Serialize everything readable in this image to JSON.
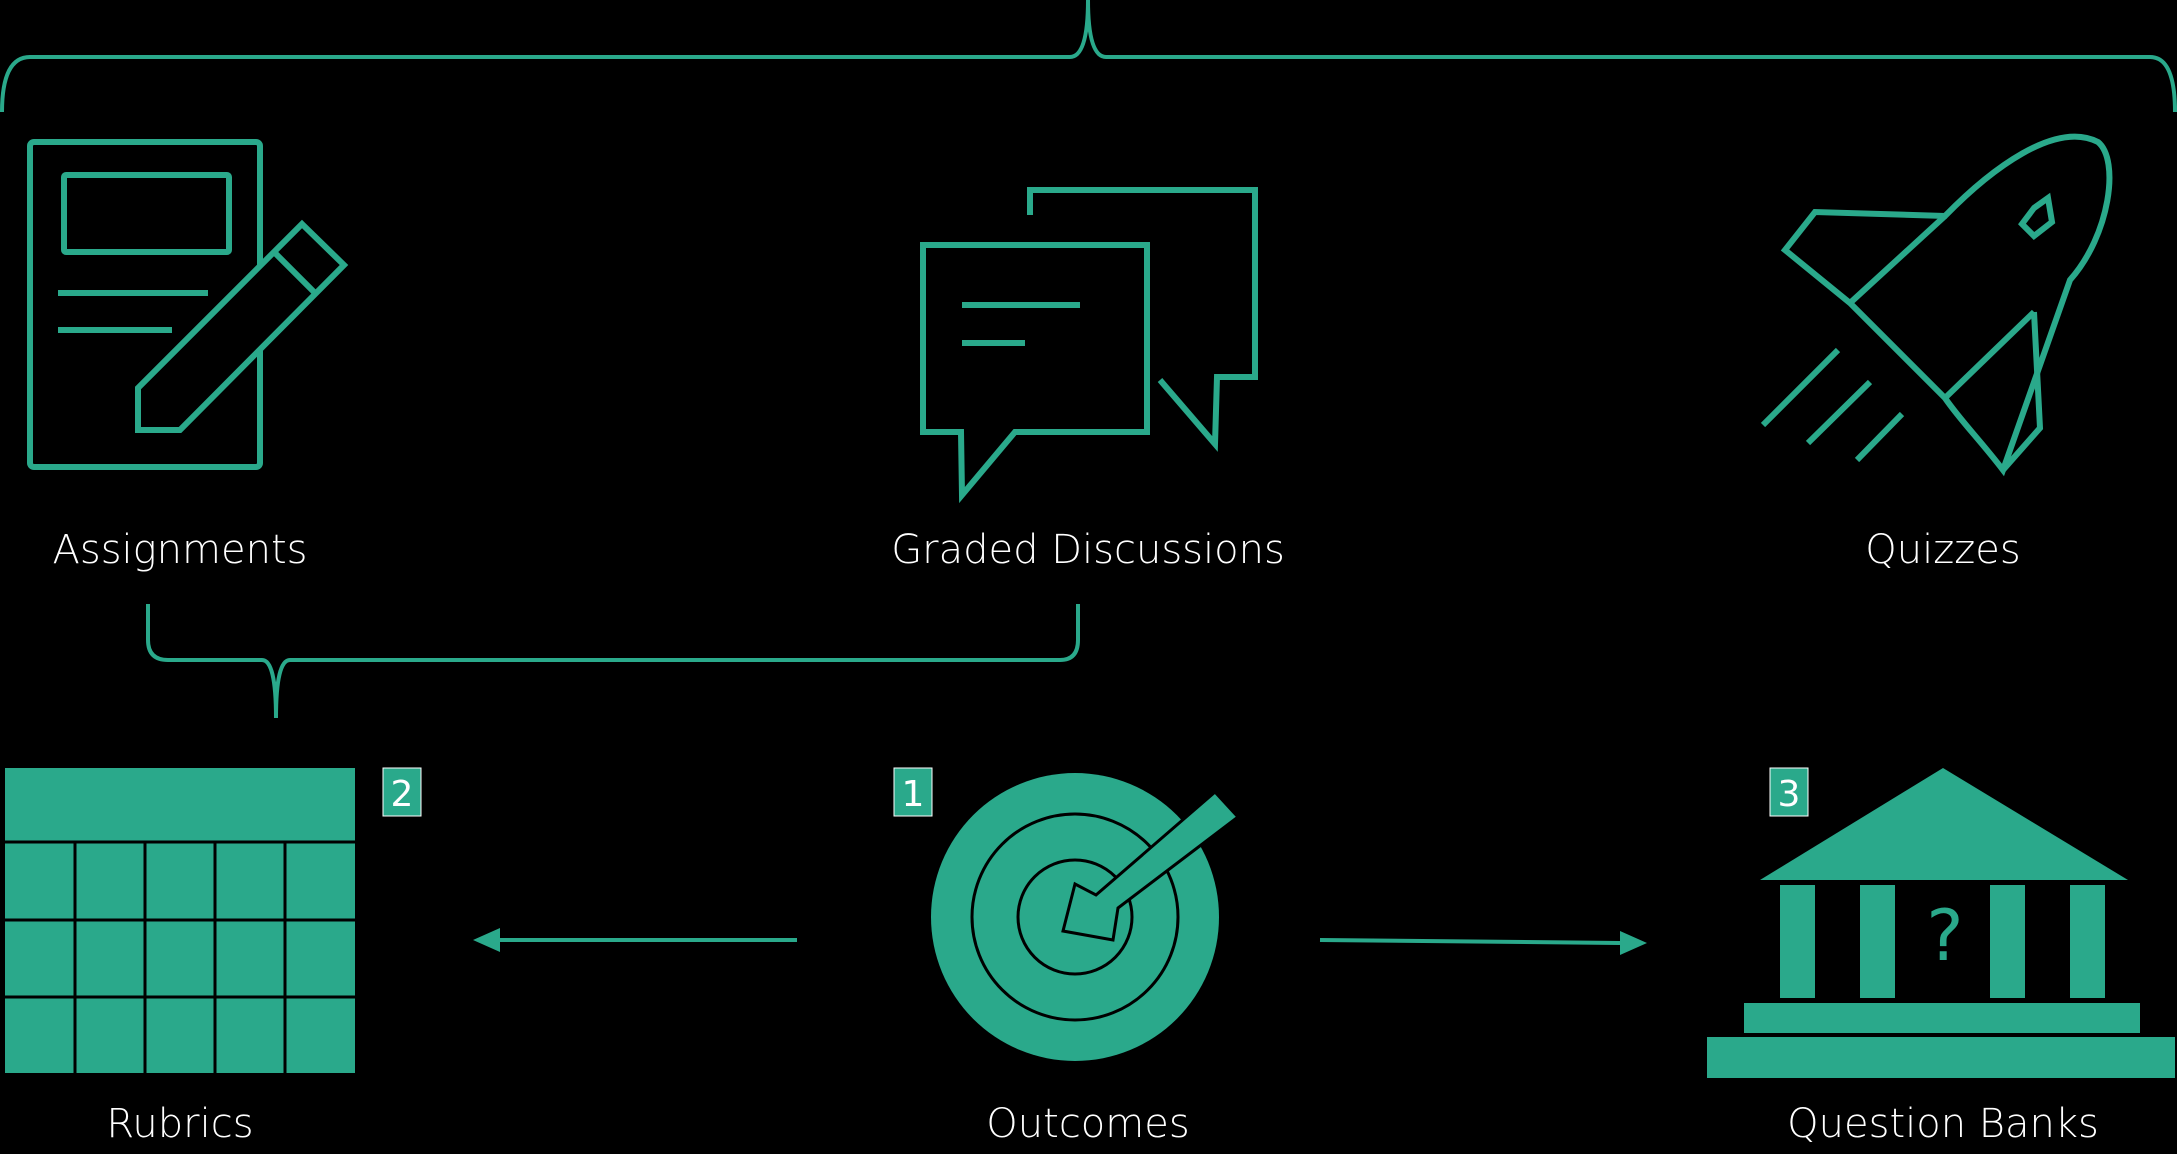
{
  "colors": {
    "background": "#000000",
    "accent": "#2aa98b",
    "text": "#ffffff"
  },
  "nodes": {
    "assignments": {
      "label": "Assignments",
      "icon": "document-pencil-icon"
    },
    "graded_discussions": {
      "label": "Graded Discussions",
      "icon": "chat-bubbles-icon"
    },
    "quizzes": {
      "label": "Quizzes",
      "icon": "rocket-icon"
    },
    "rubrics": {
      "label": "Rubrics",
      "icon": "grid-table-icon",
      "badge": "2"
    },
    "outcomes": {
      "label": "Outcomes",
      "icon": "target-icon",
      "badge": "1"
    },
    "question_banks": {
      "label": "Question Banks",
      "icon": "bank-question-icon",
      "badge": "3",
      "icon_glyph": "?"
    }
  }
}
